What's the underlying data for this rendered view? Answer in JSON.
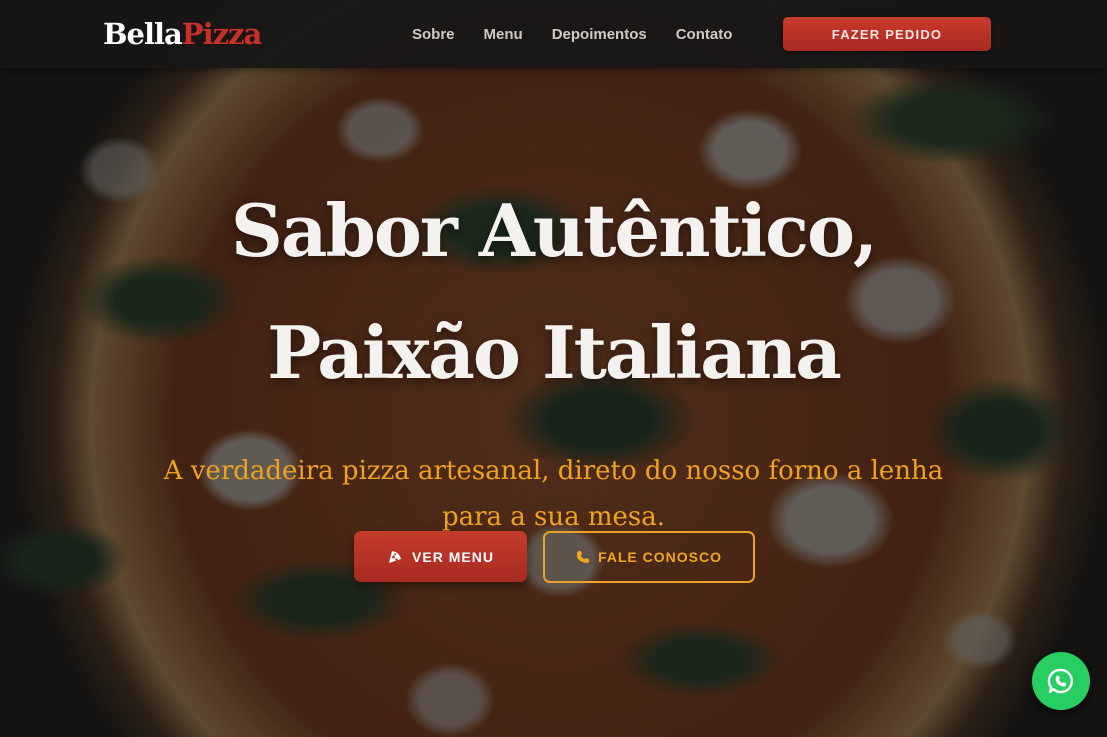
{
  "brand": {
    "part1": "Bella",
    "part2": "Pizza",
    "color_part1": "#ffffff",
    "color_part2": "#c9302a"
  },
  "nav": {
    "items": [
      {
        "label": "Sobre"
      },
      {
        "label": "Menu"
      },
      {
        "label": "Depoimentos"
      },
      {
        "label": "Contato"
      }
    ],
    "order_button": "FAZER PEDIDO"
  },
  "hero": {
    "title_line1": "Sabor Autêntico,",
    "title_line2": "Paixão Italiana",
    "subtitle": "A verdadeira pizza artesanal, direto do nosso forno a lenha para a sua mesa.",
    "primary_cta": {
      "label": "VER MENU",
      "icon": "pizza-slice-icon"
    },
    "secondary_cta": {
      "label": "FALE CONOSCO",
      "icon": "phone-icon"
    }
  },
  "floating": {
    "whatsapp_icon": "whatsapp-icon",
    "color": "#27cf63"
  },
  "colors": {
    "accent_red": "#c53a2b",
    "accent_orange": "#f0a21f",
    "header_bg": "#181716"
  }
}
